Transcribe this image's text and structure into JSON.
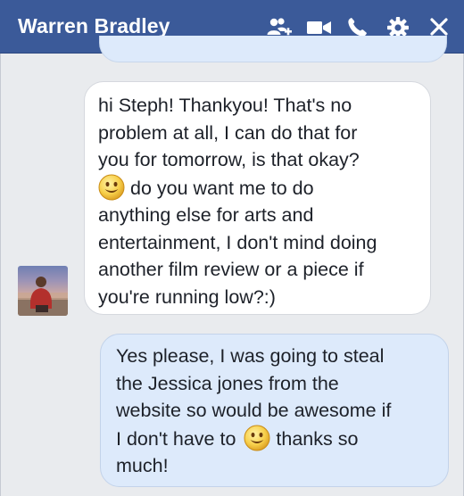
{
  "window": {
    "title": "Warren Bradley",
    "icons": [
      "add-friends-icon",
      "video-call-icon",
      "phone-icon",
      "settings-gear-icon",
      "close-icon"
    ],
    "header_color": "#3b5a99"
  },
  "messages": [
    {
      "sender": "received",
      "lines": [
        "hi Steph! Thankyou! That's no",
        "problem at all, I can do that for",
        "you for tomorrow, is that okay?",
        "do you want me to do",
        "anything else for arts and",
        "entertainment, I don't mind doing",
        "another film review or a piece if",
        "you're running low?:)"
      ],
      "emoji": "smiley-emoji"
    },
    {
      "sender": "sent",
      "lines": [
        "Yes please, I was going to steal",
        "the Jessica jones from the",
        "website so would be awesome if",
        "I don't have to",
        "thanks so",
        "much!"
      ],
      "emoji": "smiley-emoji"
    }
  ],
  "colors": {
    "received_bubble": "#ffffff",
    "sent_bubble": "#ddeafb",
    "background": "#e9ebee"
  }
}
